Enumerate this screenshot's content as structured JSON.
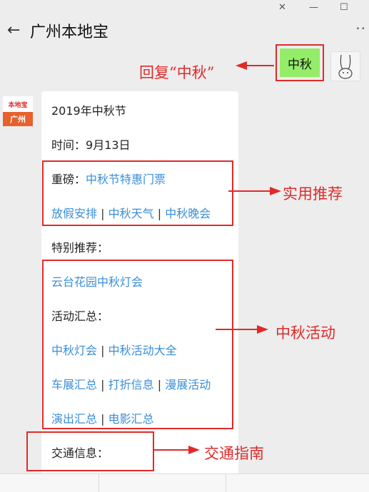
{
  "window": {
    "pin_icon": "pin-icon",
    "minimize_glyph": "—",
    "maximize_glyph": "☐"
  },
  "header": {
    "title": "广州本地宝",
    "back_icon": "back-arrow-icon",
    "more_icon": "more-icon"
  },
  "user_message": {
    "text": "中秋"
  },
  "bot_avatar": {
    "top_text": "本地宝",
    "bottom_text": "广州"
  },
  "message": {
    "title": "2019年中秋节",
    "time_label": "时间：",
    "time_value": "9月13日",
    "highlight_label": "重磅：",
    "highlight_link": "中秋节特惠门票",
    "links_row1": [
      "放假安排",
      "中秋天气",
      "中秋晚会"
    ],
    "special_label": "特别推荐：",
    "special_link": "云台花园中秋灯会",
    "events_label": "活动汇总：",
    "links_row2": [
      "中秋灯会",
      "中秋活动大全"
    ],
    "links_row3": [
      "车展汇总",
      "打折信息",
      "漫展活动"
    ],
    "links_row4": [
      "演出汇总",
      "电影汇总"
    ],
    "traffic_label": "交通信息："
  },
  "annotations": {
    "reply_hint": "回复“中秋”",
    "practical": "实用推荐",
    "mid_autumn": "中秋活动",
    "traffic": "交通指南"
  },
  "colors": {
    "link": "#3a8ed8",
    "annotation": "#e02a2a",
    "bubble": "#95ec69"
  }
}
